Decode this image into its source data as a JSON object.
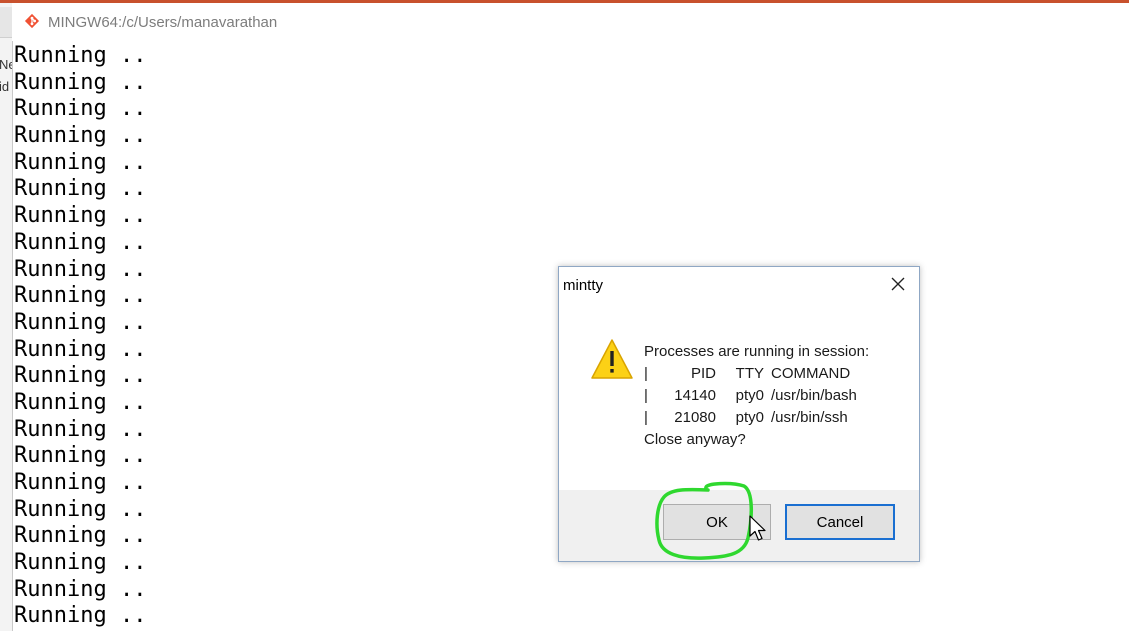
{
  "window": {
    "title": "MINGW64:/c/Users/manavarathan",
    "icon": "git-icon",
    "background_edge_text": [
      "Ne",
      "id"
    ]
  },
  "terminal": {
    "lines": [
      "Running ..",
      "Running ..",
      "Running ..",
      "Running ..",
      "Running ..",
      "Running ..",
      "Running ..",
      "Running ..",
      "Running ..",
      "Running ..",
      "Running ..",
      "Running ..",
      "Running ..",
      "Running ..",
      "Running ..",
      "Running ..",
      "Running ..",
      "Running ..",
      "Running ..",
      "Running ..",
      "Running ..",
      "Running .."
    ]
  },
  "dialog": {
    "title": "mintty",
    "close_icon": "close-icon",
    "warning_icon": "warning-icon",
    "message_heading": "Processes are running in session:",
    "table_separator": "|",
    "table_header": {
      "pid": "PID",
      "tty": "TTY",
      "command": "COMMAND"
    },
    "processes": [
      {
        "pid": "14140",
        "tty": "pty0",
        "command": "/usr/bin/bash"
      },
      {
        "pid": "21080",
        "tty": "pty0",
        "command": "/usr/bin/ssh"
      }
    ],
    "question": "Close anyway?",
    "ok_label": "OK",
    "cancel_label": "Cancel"
  },
  "colors": {
    "annotation": "#2fd82f",
    "default_button_border": "#1a6fd1",
    "title_text": "#7d7d7d"
  }
}
